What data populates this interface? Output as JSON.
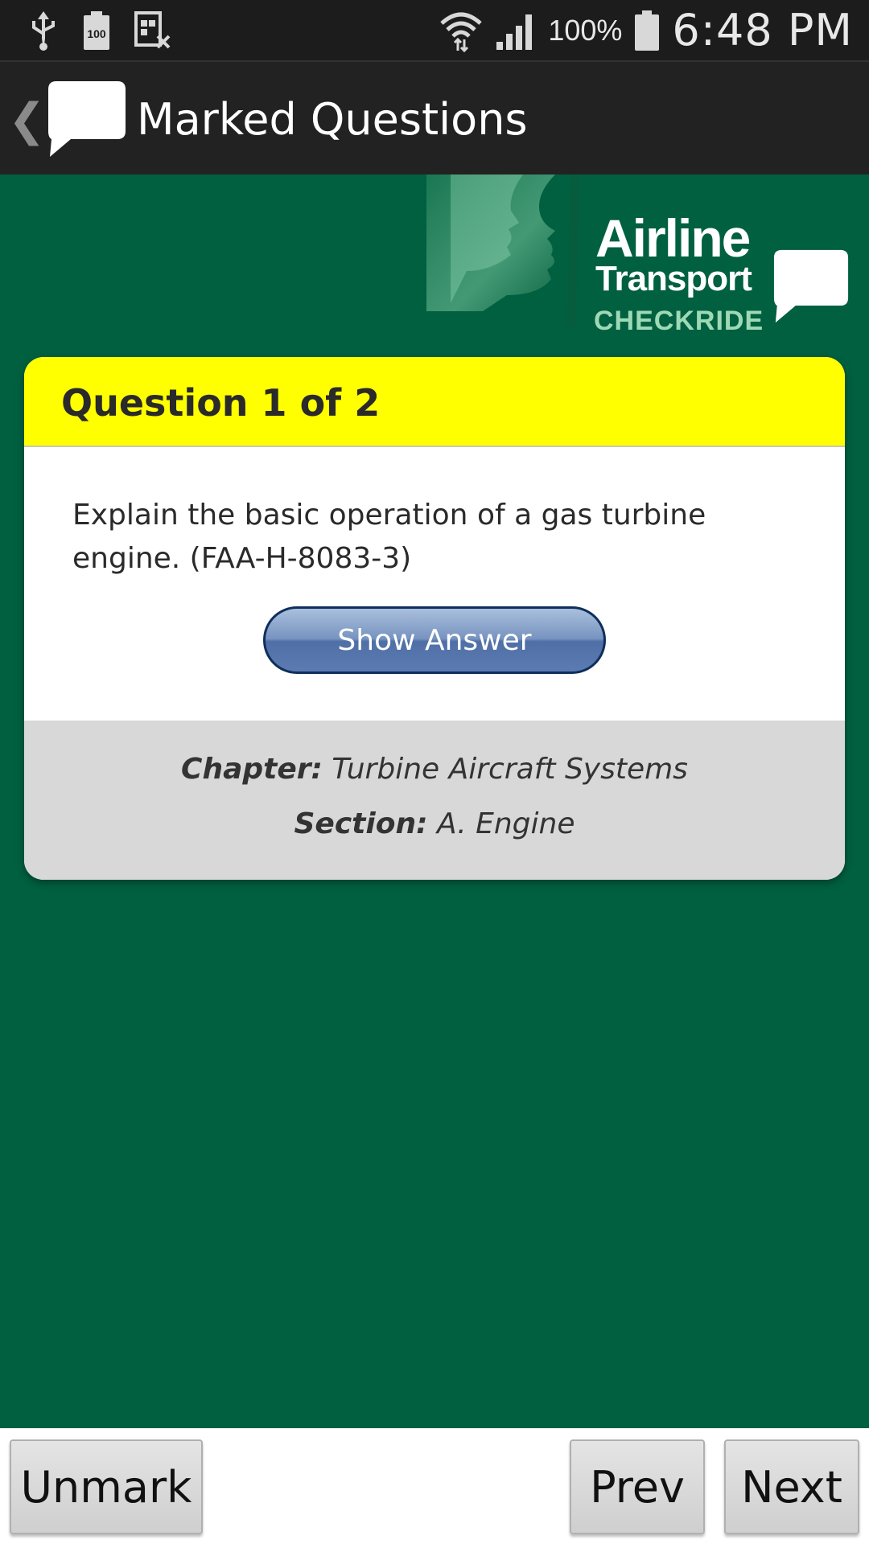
{
  "status_bar": {
    "icons": [
      "usb-icon",
      "battery-100-notification-icon",
      "screenshot-icon",
      "wifi-icon",
      "signal-icon",
      "battery-icon"
    ],
    "battery_percent": "100%",
    "time": "6:48 PM"
  },
  "action_bar": {
    "title": "Marked Questions",
    "back_icon": "chevron-left-icon",
    "logo_icon": "speech-bubble-icon"
  },
  "brand": {
    "line1": "Airline",
    "line2": "Transport",
    "line3": "CHECKRIDE"
  },
  "card": {
    "header": "Question 1 of 2",
    "question": "Explain the basic operation of a gas turbine engine. (FAA-H-8083-3)",
    "show_answer_label": "Show Answer",
    "chapter_label": "Chapter:",
    "chapter_value": "Turbine Aircraft Systems",
    "section_label": "Section:",
    "section_value": "A. Engine"
  },
  "bottom_bar": {
    "unmark_label": "Unmark",
    "prev_label": "Prev",
    "next_label": "Next"
  },
  "colors": {
    "background": "#006040",
    "header_yellow": "#ffff00",
    "action_bar": "#222222",
    "button_blue": "#5b7bb2"
  }
}
